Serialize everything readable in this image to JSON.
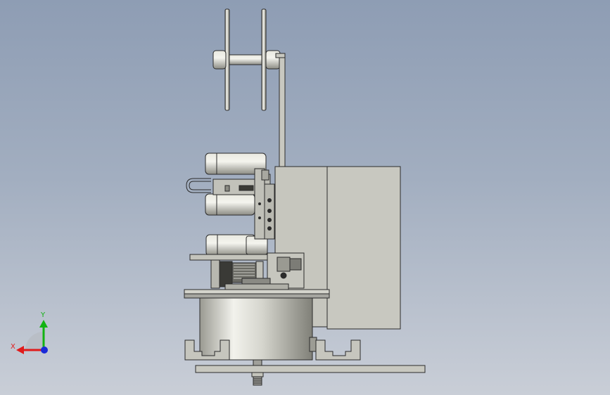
{
  "viewport": {
    "background_top": "#8e9db4",
    "background_bottom": "#c9ced7"
  },
  "model": {
    "part_color": "#c8c8c0",
    "edge_color": "#2b2b2b",
    "metal_highlight": "#f0f0ea",
    "metal_shadow": "#8a8a82"
  },
  "triad": {
    "x_label": "X",
    "y_label": "Y",
    "x_color": "#e01b1b",
    "y_color": "#12b312",
    "z_color": "#1a2ad8"
  }
}
